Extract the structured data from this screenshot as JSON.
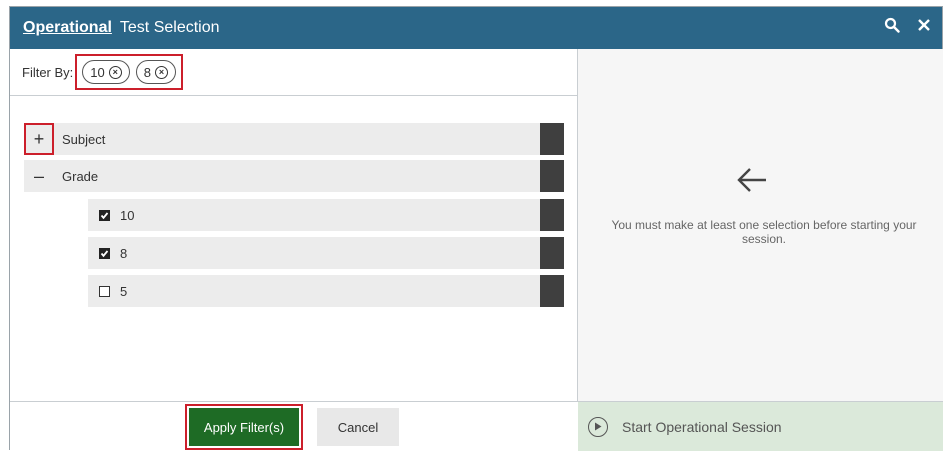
{
  "titlebar": {
    "title_strong": "Operational",
    "title_rest": "Test Selection",
    "icons": [
      "search-icon",
      "close-icon"
    ]
  },
  "filter": {
    "label": "Filter By:",
    "chips": [
      "10",
      "8"
    ]
  },
  "tree": {
    "subject": {
      "toggle": "+",
      "label": "Subject"
    },
    "grade": {
      "toggle": "–",
      "label": "Grade"
    },
    "grade_items": [
      {
        "label": "10",
        "checked": true
      },
      {
        "label": "8",
        "checked": true
      },
      {
        "label": "5",
        "checked": false
      }
    ]
  },
  "footer": {
    "apply_label": "Apply Filter(s)",
    "cancel_label": "Cancel"
  },
  "right_panel": {
    "message": "You must make at least one selection before starting your session.",
    "start_label": "Start Operational Session"
  },
  "colors": {
    "titlebar": "#2b6688",
    "apply_button": "#1e6b25",
    "highlight": "#cc1f2b",
    "start_bar": "#dbe9da"
  }
}
